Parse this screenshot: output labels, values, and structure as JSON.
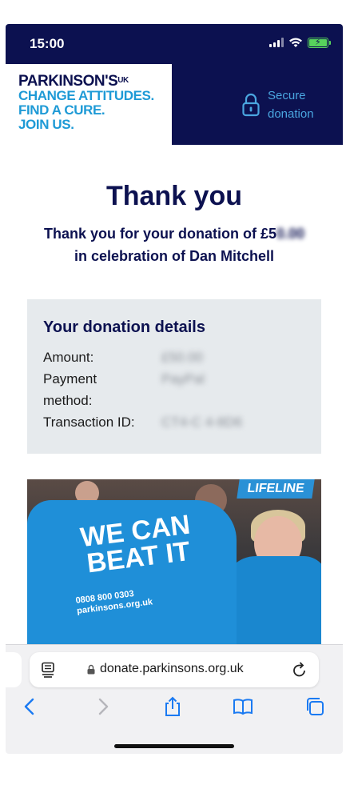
{
  "status_bar": {
    "time": "15:00"
  },
  "header": {
    "logo": {
      "name": "PARKINSON'S",
      "suffix": "UK",
      "lines": [
        "CHANGE ATTITUDES.",
        "FIND A CURE.",
        "JOIN US."
      ]
    },
    "secure_lines": [
      "Secure",
      "donation"
    ]
  },
  "main": {
    "title": "Thank you",
    "subtitle_prefix": "Thank you for your donation of £5",
    "subtitle_obscured": "0.00",
    "subtitle_line2": "in celebration of Dan Mitchell"
  },
  "details": {
    "title": "Your donation details",
    "rows": [
      {
        "label": "Amount:",
        "value": "£50.00"
      },
      {
        "label": "Payment method:",
        "value": "PayPal"
      },
      {
        "label": "Transaction ID:",
        "value": "CT4-C 4-8D6"
      }
    ]
  },
  "photo": {
    "sign": "LIFELINE",
    "slogan_line1": "WE CAN",
    "slogan_line2": "BEAT IT",
    "phone": "0808 800 0303",
    "site": "parkinsons.org.uk"
  },
  "browser": {
    "url": "donate.parkinsons.org.uk"
  },
  "colors": {
    "navy": "#0c1150",
    "accent_blue": "#1e9ad6",
    "details_bg": "#e6eaed"
  }
}
